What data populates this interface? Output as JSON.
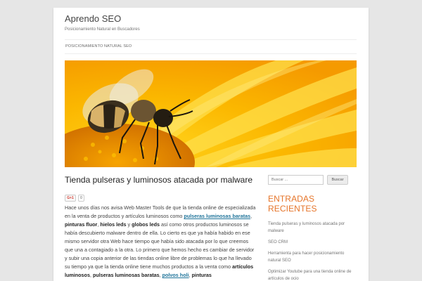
{
  "site": {
    "title": "Aprendo SEO",
    "description": "Posicionamiento Natural en Buscadores"
  },
  "nav": {
    "items": [
      "POSICIONAMIENTO NATURAL SEO"
    ]
  },
  "post": {
    "title": "Tienda pulseras y luminosos atacada por malware",
    "share": {
      "gplus_label": "G+1",
      "count": "0"
    },
    "segments": [
      {
        "t": "Hace unos días nos avisa Web Master Tools de que la tienda online de especializada en la venta de productos y artículos luminosos como ",
        "s": "text"
      },
      {
        "t": "pulseras luminosas baratas",
        "s": "link"
      },
      {
        "t": ", ",
        "s": "text"
      },
      {
        "t": "pinturas fluor",
        "s": "bold"
      },
      {
        "t": ", ",
        "s": "text"
      },
      {
        "t": "hielos leds",
        "s": "bold"
      },
      {
        "t": " y ",
        "s": "text"
      },
      {
        "t": "globos leds",
        "s": "bold"
      },
      {
        "t": " así como otros productos luminosos se había descubierto malware dentro de ella. Lo cierto es que ya había habido en ese mismo servidor otra Web hace tiempo que había sido atacada por lo que creemos que una a contagiado a la otra. Lo primero que hemos hecho es cambiar de servidor y subir una copia anterior de las tiendas online libre de problemas lo que ha llevado su tiempo ya que la tienda online tiene muchos productos a la venta como ",
        "s": "text"
      },
      {
        "t": "artículos luminosos",
        "s": "bold"
      },
      {
        "t": ", ",
        "s": "text"
      },
      {
        "t": "pulseras luminosas baratas",
        "s": "bold"
      },
      {
        "t": ", ",
        "s": "text"
      },
      {
        "t": "polvos holi",
        "s": "link"
      },
      {
        "t": ", ",
        "s": "text"
      },
      {
        "t": "pinturas",
        "s": "bold"
      }
    ]
  },
  "sidebar": {
    "search": {
      "placeholder": "Buscar ...",
      "button_label": "Buscar"
    },
    "recent_title": "ENTRADAS RECIENTES",
    "recent": [
      "Tienda pulseras y luminosos atacada por malware",
      "SEO CRM",
      "Herramienta para hacer posicionamiento natural SEO",
      "Optimizar Youtube para una tienda online de artículos de ocio"
    ]
  },
  "colors": {
    "accent": "#e6752a",
    "link": "#21759b",
    "background": "#e6e6e6"
  }
}
